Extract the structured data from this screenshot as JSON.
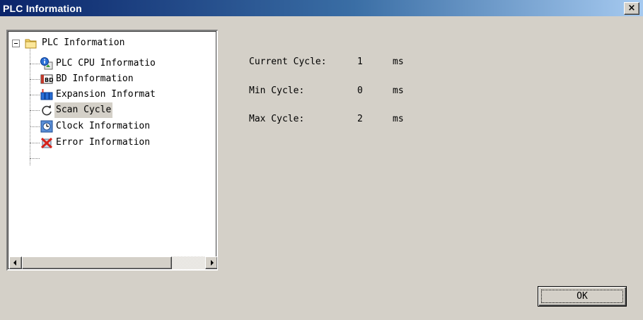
{
  "window": {
    "title": "PLC Information",
    "close_glyph": "×",
    "close_icon": "close-icon"
  },
  "tree": {
    "root": {
      "label": "PLC Information",
      "expanded": true,
      "icon": "folder-icon"
    },
    "items": [
      {
        "label": "PLC CPU Informatio",
        "icon": "cpu-info-icon",
        "selected": false
      },
      {
        "label": "BD Information",
        "icon": "bd-board-icon",
        "selected": false
      },
      {
        "label": "Expansion Informat",
        "icon": "expansion-module-icon",
        "selected": false
      },
      {
        "label": "Scan Cycle",
        "icon": "refresh-cycle-icon",
        "selected": true
      },
      {
        "label": "Clock Information",
        "icon": "clock-icon",
        "selected": false
      },
      {
        "label": "Error Information",
        "icon": "error-icon",
        "selected": false
      }
    ]
  },
  "scan_cycle": {
    "current": {
      "label": "Current Cycle:",
      "value": "1",
      "unit": "ms"
    },
    "min": {
      "label": "Min Cycle:",
      "value": "0",
      "unit": "ms"
    },
    "max": {
      "label": "Max Cycle:",
      "value": "2",
      "unit": "ms"
    }
  },
  "buttons": {
    "ok_label": "OK"
  },
  "colors": {
    "titlebar_start": "#0a246a",
    "titlebar_end": "#a6caf0",
    "dialog_bg": "#d4d0c8",
    "selection_bg": "#d4d0c8"
  }
}
